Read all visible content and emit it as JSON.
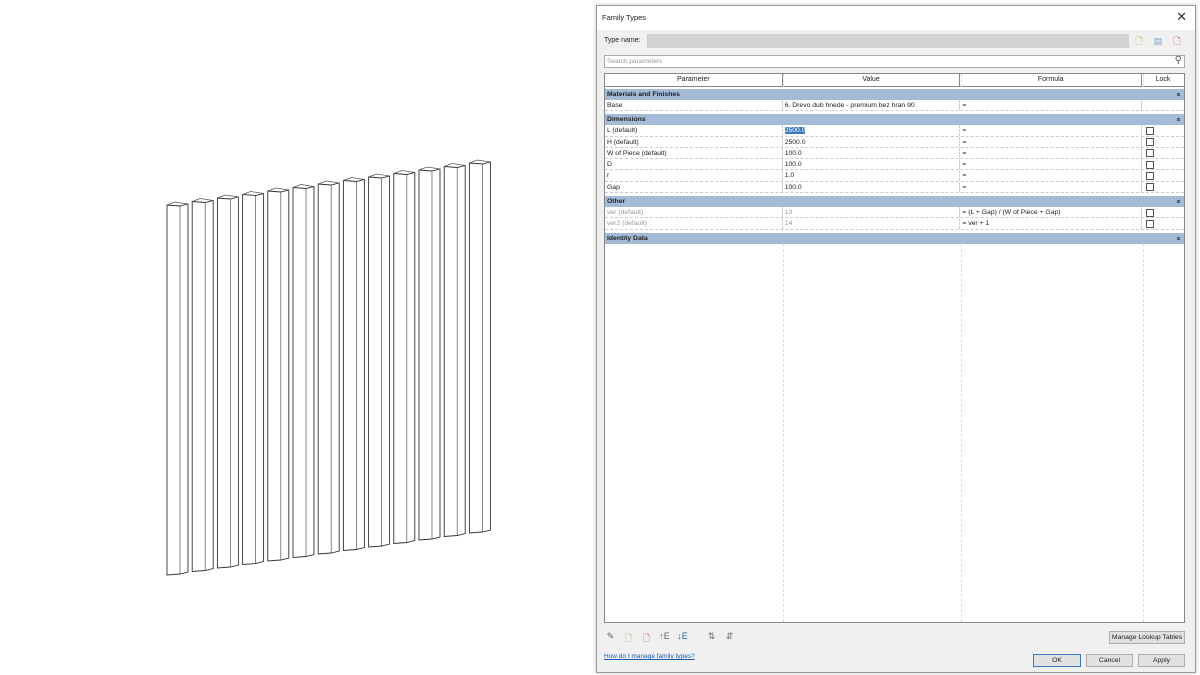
{
  "dialog": {
    "title": "Family Types",
    "close_icon": "close-icon",
    "type_name_label": "Type name:",
    "type_name_value": "",
    "search_placeholder": "Search parameters",
    "columns": [
      "Parameter",
      "Value",
      "Formula",
      "Lock"
    ],
    "groups": [
      {
        "name": "Materials and Finishes",
        "collapsed": false,
        "rows": [
          {
            "param": "Base",
            "value": "6. Drevo dub hnede - premium bez hran 90",
            "formula": "=",
            "lock": null,
            "dim": false
          }
        ]
      },
      {
        "name": "Dimensions",
        "collapsed": false,
        "rows": [
          {
            "param": "L (default)",
            "value": "2500.0",
            "formula": "=",
            "lock": false,
            "dim": false,
            "selected": true
          },
          {
            "param": "H (default)",
            "value": "2500.0",
            "formula": "=",
            "lock": false,
            "dim": false
          },
          {
            "param": "W of Piece (default)",
            "value": "100.0",
            "formula": "=",
            "lock": false,
            "dim": false
          },
          {
            "param": "D",
            "value": "100.0",
            "formula": "=",
            "lock": false,
            "dim": false
          },
          {
            "param": "r",
            "value": "1.0",
            "formula": "=",
            "lock": false,
            "dim": false
          },
          {
            "param": "Gap",
            "value": "100.0",
            "formula": "=",
            "lock": false,
            "dim": false
          }
        ]
      },
      {
        "name": "Other",
        "collapsed": false,
        "rows": [
          {
            "param": "ver (default)",
            "value": "13",
            "formula": "= (L + Gap) / (W of Piece + Gap)",
            "lock": false,
            "dim": true
          },
          {
            "param": "ver2 (default)",
            "value": "14",
            "formula": "= ver + 1",
            "lock": false,
            "dim": true
          }
        ]
      },
      {
        "name": "Identity Data",
        "collapsed": true,
        "rows": []
      }
    ],
    "manage_lookup_label": "Manage Lookup Tables",
    "help_link": "How do I manage family types?",
    "ok_label": "OK",
    "cancel_label": "Cancel",
    "apply_label": "Apply",
    "header_colors": {
      "group": "#a3bbd6",
      "selection": "#3a78c4"
    }
  }
}
